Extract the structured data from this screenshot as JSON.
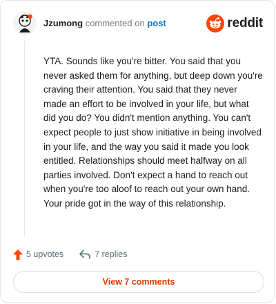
{
  "header": {
    "username": "Jzumong",
    "action_text": "commented on",
    "post_link": "post",
    "brand": "reddit",
    "brand_color": "#ff4500"
  },
  "comment": {
    "text": "YTA. Sounds like you're bitter. You said that you never asked them for anything, but deep down you're craving their attention. You said that they never made an effort to be involved in your life, but what did you do? You didn't mention anything. You can't expect people to just show initiative in being involved in your life, and the way you said it made you look entitled. Relationships should meet halfway on all parties involved. Don't expect a hand to reach out when you're too aloof to reach out your own hand. Your pride got in the way of this relationship."
  },
  "actions": {
    "upvotes": "5 upvotes",
    "replies": "7 replies",
    "upvote_icon": "upvote-arrow-icon",
    "reply_icon": "reply-arrow-icon"
  },
  "footer": {
    "view_comments": "View 7 comments",
    "accent": "#d93a00"
  }
}
